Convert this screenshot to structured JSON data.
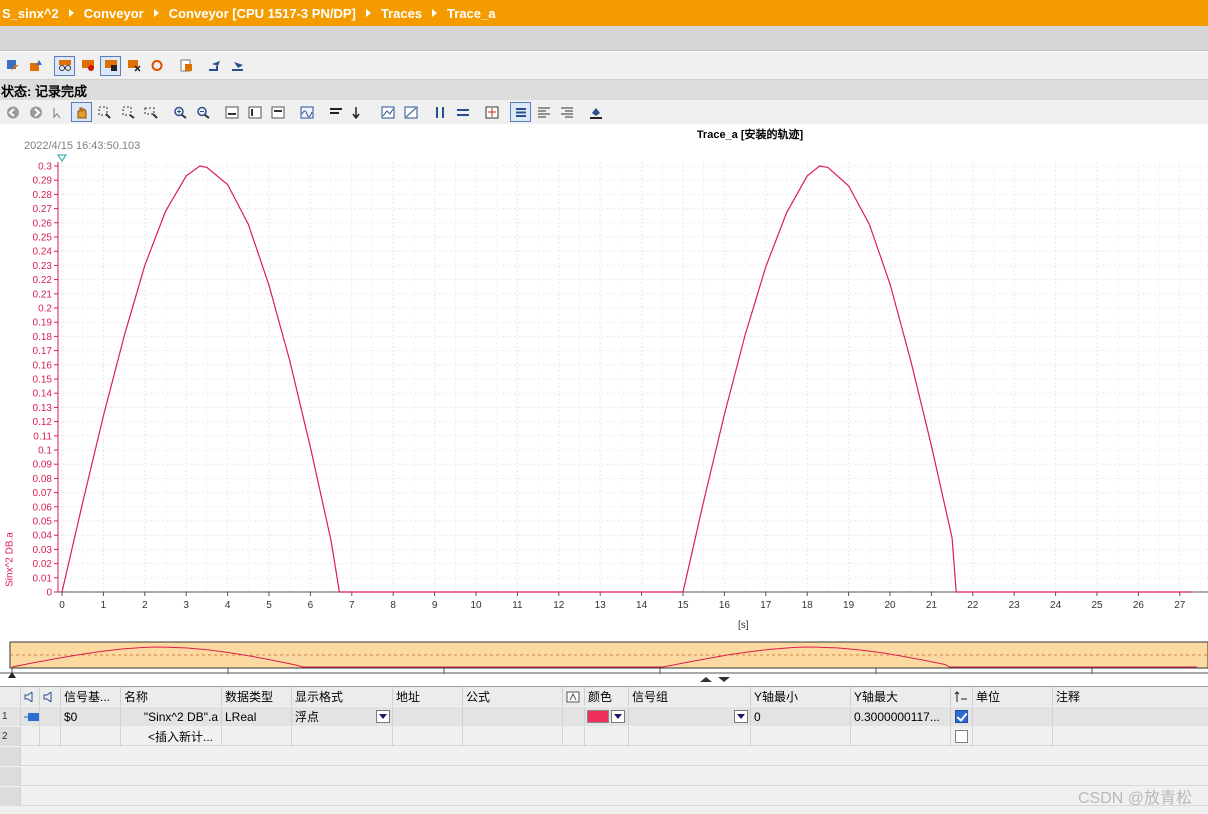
{
  "breadcrumb": [
    "S_sinx^2",
    "Conveyor",
    "Conveyor [CPU 1517-3 PN/DP]",
    "Traces",
    "Trace_a"
  ],
  "status": "状态: 记录完成",
  "chart": {
    "title": "Trace_a [安装的轨迹]",
    "timestamp": "2022/4/15 16:43:50.103",
    "y_axis_label": "Sinx^2 DB.a",
    "x_unit": "[s]",
    "y_ticks": [
      "0.3",
      "0.29",
      "0.28",
      "0.27",
      "0.26",
      "0.25",
      "0.24",
      "0.23",
      "0.22",
      "0.21",
      "0.2",
      "0.19",
      "0.18",
      "0.17",
      "0.16",
      "0.15",
      "0.14",
      "0.13",
      "0.12",
      "0.11",
      "0.1",
      "0.09",
      "0.08",
      "0.07",
      "0.06",
      "0.05",
      "0.04",
      "0.03",
      "0.02",
      "0.01",
      "0"
    ],
    "x_ticks": [
      "0",
      "1",
      "2",
      "3",
      "4",
      "5",
      "6",
      "7",
      "8",
      "9",
      "10",
      "11",
      "12",
      "13",
      "14",
      "15",
      "16",
      "17",
      "18",
      "19",
      "20",
      "21",
      "22",
      "23",
      "24",
      "25",
      "26",
      "27"
    ],
    "line_color": "#dc1e50"
  },
  "chart_data": {
    "type": "line",
    "title": "Trace_a [安装的轨迹]",
    "xlabel": "[s]",
    "ylabel": "Sinx^2 DB.a",
    "xlim": [
      0,
      27.3
    ],
    "ylim": [
      0,
      0.3
    ],
    "grid": true,
    "series": [
      {
        "name": "Sinx^2 DB.a",
        "x": [
          0,
          0.5,
          1,
          1.5,
          2,
          2.5,
          3,
          3.33,
          3.5,
          4,
          4.5,
          5,
          5.5,
          6,
          6.5,
          6.7,
          7,
          10,
          13,
          15,
          15.5,
          16,
          16.5,
          17,
          17.5,
          18,
          18.3,
          18.5,
          19,
          19.5,
          20,
          20.5,
          21,
          21.5,
          21.6,
          22,
          25,
          27.3
        ],
        "y": [
          0,
          0.063,
          0.124,
          0.18,
          0.23,
          0.268,
          0.293,
          0.3,
          0.299,
          0.287,
          0.259,
          0.216,
          0.163,
          0.102,
          0.036,
          0,
          0,
          0,
          0,
          0,
          0.064,
          0.125,
          0.181,
          0.229,
          0.267,
          0.293,
          0.3,
          0.299,
          0.286,
          0.259,
          0.217,
          0.163,
          0.103,
          0.038,
          0,
          0,
          0,
          0
        ]
      }
    ]
  },
  "table": {
    "headers": [
      "信号基...",
      "名称",
      "数据类型",
      "显示格式",
      "地址",
      "公式",
      "颜色",
      "信号组",
      "Y轴最小",
      "Y轴最大",
      "单位",
      "注释"
    ],
    "rows": [
      {
        "num": "1",
        "base": "$0",
        "name": "\"Sinx^2 DB\".a",
        "dtype": "LReal",
        "format": "浮点",
        "ymin": "0",
        "ymax": "0.3000000117...",
        "color": "#f0305a",
        "checked": true
      },
      {
        "num": "2",
        "name": "<插入新计..."
      }
    ]
  },
  "watermark": "CSDN @放青松"
}
